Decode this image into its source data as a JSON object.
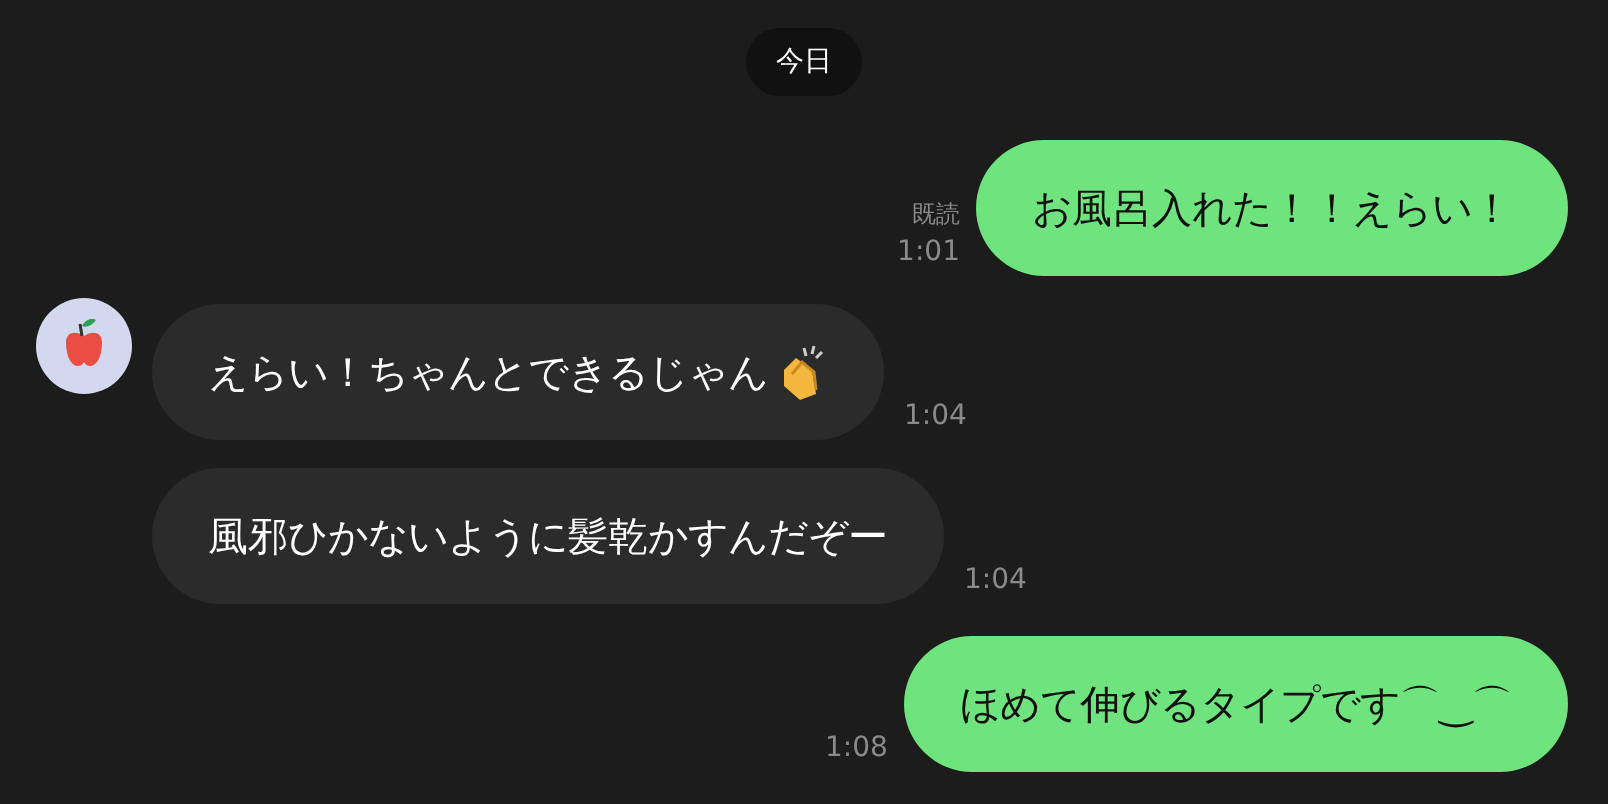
{
  "date_chip": "今日",
  "messages": [
    {
      "kind": "sent",
      "text": "お風呂入れた！！えらい！",
      "read_label": "既読",
      "time": "1:01",
      "avatar": false,
      "trailing_icon": false
    },
    {
      "kind": "received",
      "text": "えらい！ちゃんとできるじゃん",
      "time": "1:04",
      "avatar": true,
      "trailing_icon": true
    },
    {
      "kind": "received",
      "text": "風邪ひかないように髪乾かすんだぞー",
      "time": "1:04",
      "avatar": false,
      "trailing_icon": false
    },
    {
      "kind": "sent",
      "text": "ほめて伸びるタイプです⌒‿⌒",
      "time": "1:08",
      "avatar": false,
      "trailing_icon": false
    }
  ]
}
